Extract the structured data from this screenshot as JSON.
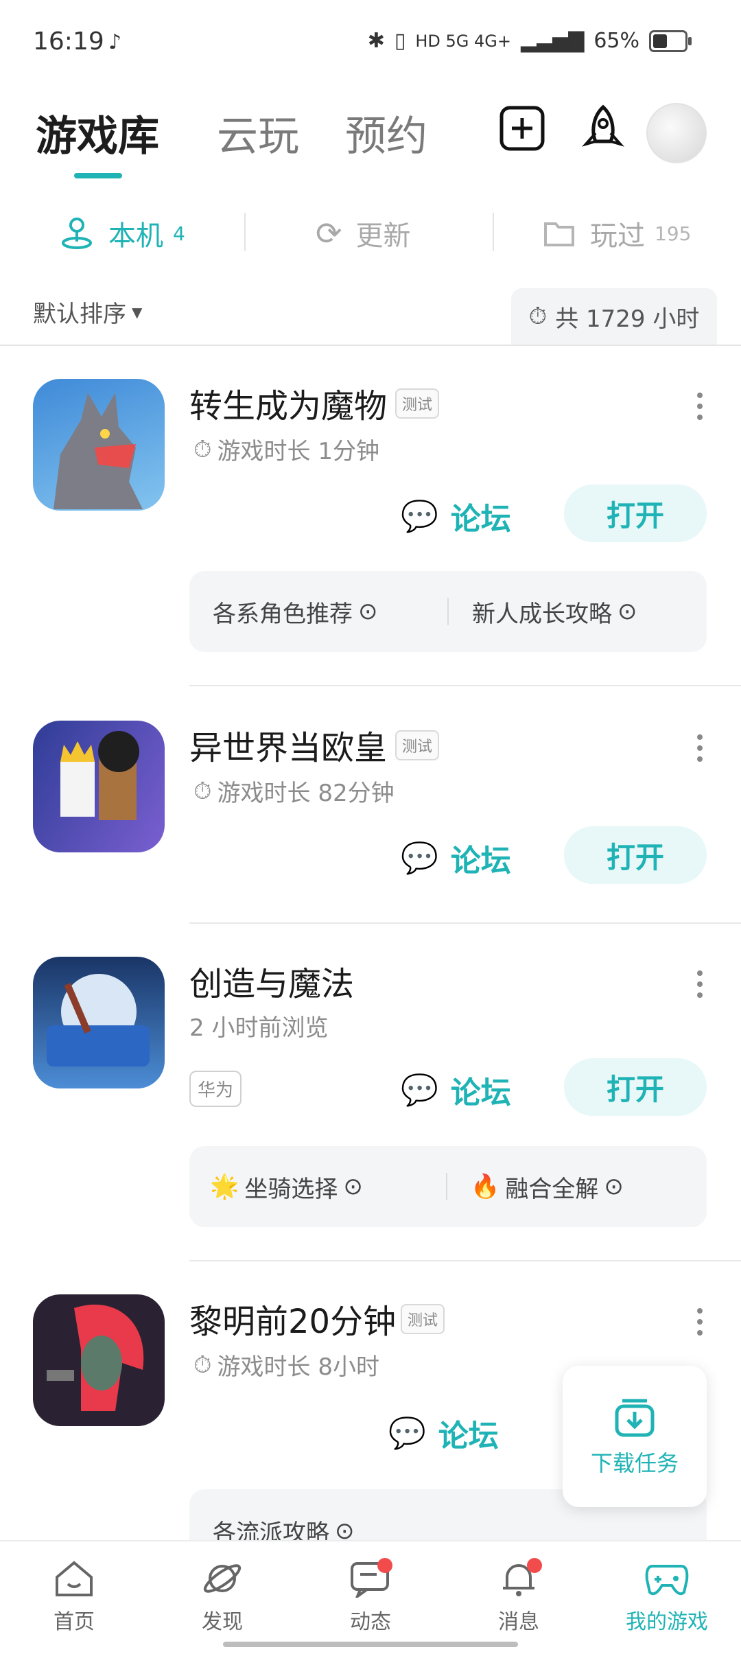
{
  "status_bar": {
    "time": "16:19",
    "network": "HD 5G 4G+",
    "battery": "65%"
  },
  "header": {
    "tabs": [
      "游戏库",
      "云玩",
      "预约"
    ]
  },
  "subtabs": {
    "local": {
      "label": "本机",
      "count": "4"
    },
    "update": {
      "label": "更新"
    },
    "played": {
      "label": "玩过",
      "count": "195"
    }
  },
  "sort": {
    "label": "默认排序"
  },
  "total_time": "共 1729 小时",
  "games": [
    {
      "title": "转生成为魔物",
      "badge": "测试",
      "subtitle": "游戏时长 1分钟",
      "forum": "论坛",
      "open": "打开",
      "tips": [
        "各系角色推荐",
        "新人成长攻略"
      ]
    },
    {
      "title": "异世界当欧皇",
      "badge": "测试",
      "subtitle": "游戏时长 82分钟",
      "forum": "论坛",
      "open": "打开"
    },
    {
      "title": "创造与魔法",
      "subtitle": "2 小时前浏览",
      "tag": "华为",
      "forum": "论坛",
      "open": "打开",
      "tips": [
        "坐骑选择",
        "融合全解"
      ]
    },
    {
      "title": "黎明前20分钟",
      "badge": "测试",
      "subtitle": "游戏时长 8小时",
      "forum": "论坛",
      "tips": [
        "各流派攻略"
      ]
    }
  ],
  "download_task": "下载任务",
  "nav": [
    {
      "label": "首页",
      "icon": "home-icon"
    },
    {
      "label": "发现",
      "icon": "planet-icon"
    },
    {
      "label": "动态",
      "icon": "chat-icon"
    },
    {
      "label": "消息",
      "icon": "bell-icon"
    },
    {
      "label": "我的游戏",
      "icon": "gamepad-icon"
    }
  ],
  "colors": {
    "accent": "#1fb3b5",
    "badge_dot": "#f24b4b"
  }
}
